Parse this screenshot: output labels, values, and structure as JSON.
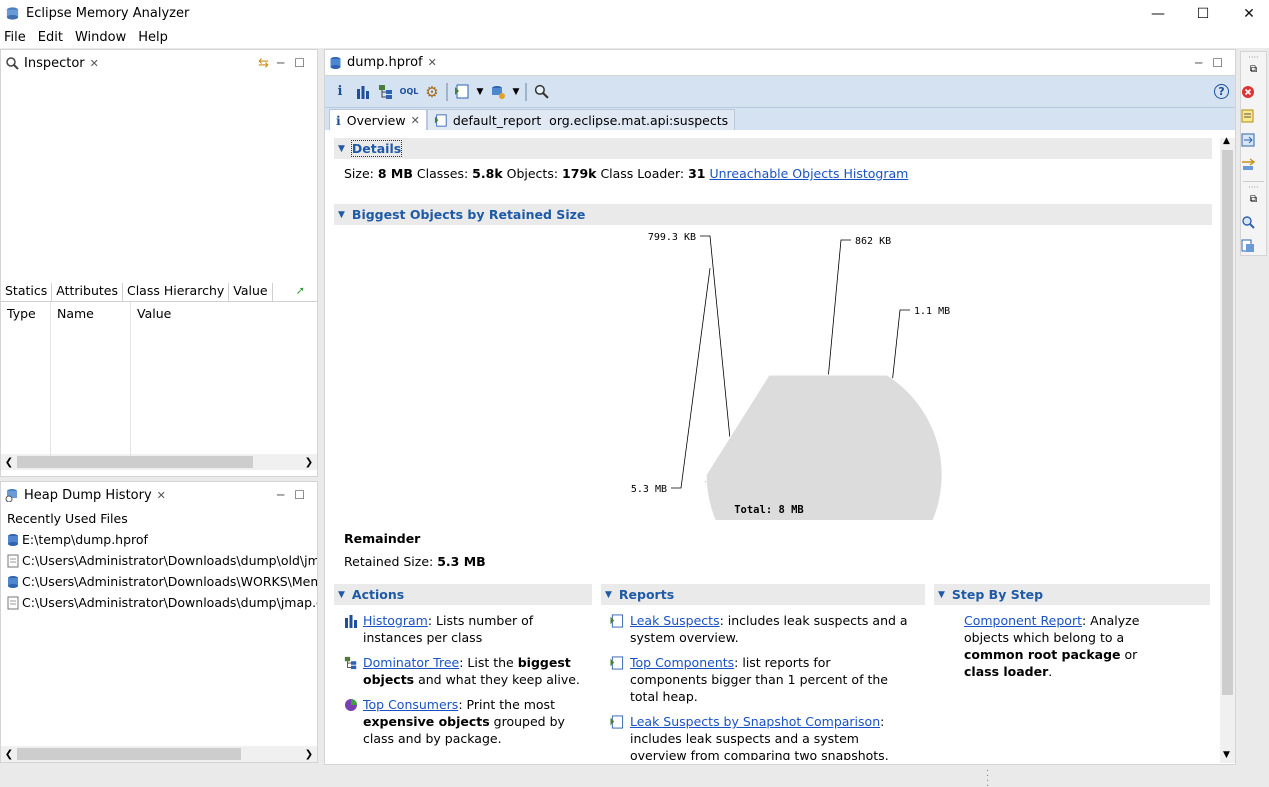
{
  "window": {
    "title": "Eclipse Memory Analyzer",
    "controls": [
      "—",
      "☐",
      "✕"
    ]
  },
  "menu": [
    "File",
    "Edit",
    "Window",
    "Help"
  ],
  "inspector": {
    "title": "Inspector",
    "tabs": [
      "Statics",
      "Attributes",
      "Class Hierarchy",
      "Value"
    ],
    "columns": [
      "Type",
      "Name",
      "Value"
    ]
  },
  "history": {
    "title": "Heap Dump History",
    "section_label": "Recently Used Files",
    "files": [
      "E:\\temp\\dump.hprof",
      "C:\\Users\\Administrator\\Downloads\\dump\\old\\jmap",
      "C:\\Users\\Administrator\\Downloads\\WORKS\\Memc",
      "C:\\Users\\Administrator\\Downloads\\dump\\jmap.du"
    ]
  },
  "editor": {
    "tab_label": "dump.hprof",
    "inner_tabs": [
      "Overview",
      "default_report  org.eclipse.mat.api:suspects"
    ],
    "details": {
      "heading": "Details",
      "size_label": "Size:",
      "size_value": "8 MB",
      "classes_label": "Classes:",
      "classes_value": "5.8k",
      "objects_label": "Objects:",
      "objects_value": "179k",
      "loader_label": "Class Loader:",
      "loader_value": "31",
      "link": "Unreachable Objects Histogram"
    },
    "biggest": {
      "heading": "Biggest Objects by Retained Size",
      "remainder_title": "Remainder",
      "retained_label": "Retained Size:",
      "retained_value": "5.3 MB"
    },
    "actions": {
      "heading": "Actions",
      "items": [
        {
          "link": "Histogram",
          "t1": ": Lists number of instances per class",
          "b1": "",
          "t2": ""
        },
        {
          "link": "Dominator Tree",
          "t1": ": List the ",
          "b1": "biggest objects",
          "t2": " and what they keep alive."
        },
        {
          "link": "Top Consumers",
          "t1": ": Print the most ",
          "b1": "expensive objects",
          "t2": " grouped by class and by package."
        }
      ]
    },
    "reports": {
      "heading": "Reports",
      "items": [
        {
          "link": "Leak Suspects",
          "text": ": includes leak suspects and a system overview."
        },
        {
          "link": "Top Components",
          "text": ": list reports for components bigger than 1 percent of the total heap."
        },
        {
          "link": "Leak Suspects by Snapshot Comparison",
          "text": ": includes leak suspects and a system overview from comparing two snapshots."
        }
      ]
    },
    "stepbystep": {
      "heading": "Step By Step",
      "link": "Component Report",
      "t1": ": Analyze objects which belong to a ",
      "b1": "common root package",
      "t2": " or ",
      "b2": "class loader",
      "t3": "."
    }
  },
  "chart_data": {
    "type": "pie",
    "title": "",
    "total_label": "Total: 8 MB",
    "slices": [
      {
        "label": "1.1 MB",
        "value": 1.1,
        "color": "#607d8b"
      },
      {
        "label": "862 KB",
        "value": 0.842,
        "color": "#5f9595"
      },
      {
        "label": "799.3 KB",
        "value": 0.781,
        "color": "#6e8b4e"
      },
      {
        "label": "5.3 MB",
        "value": 5.3,
        "color": "#dcdcdc"
      }
    ]
  },
  "colors": {
    "toolbar": "#d5e2f1",
    "section_header": "#1f5aa6",
    "link": "#1a52c4"
  }
}
